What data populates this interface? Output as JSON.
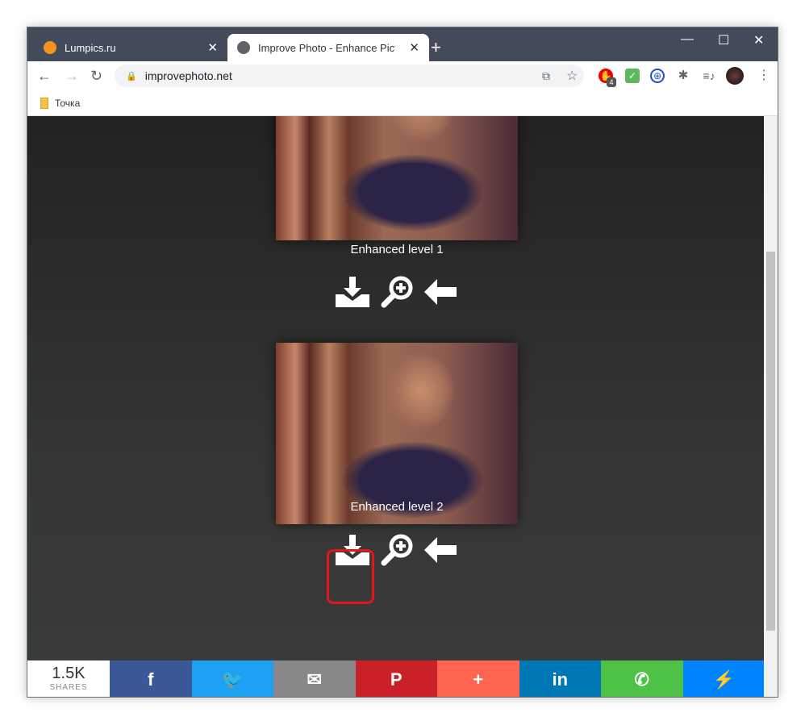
{
  "browser": {
    "tabs": [
      {
        "title": "Lumpics.ru",
        "active": false
      },
      {
        "title": "Improve Photo - Enhance Picture",
        "active": true
      }
    ],
    "url": "improvephoto.net",
    "bookmarks": [
      {
        "label": "Точка"
      }
    ],
    "extension_badge": "4"
  },
  "page": {
    "results": [
      {
        "caption": "Enhanced level 1"
      },
      {
        "caption": "Enhanced level 2"
      }
    ],
    "highlight_color": "#e3161b"
  },
  "share": {
    "count": "1.5K",
    "count_label": "SHARES",
    "buttons": [
      {
        "name": "facebook",
        "glyph": "f",
        "color": "#3b5998"
      },
      {
        "name": "twitter",
        "glyph": "🐦",
        "color": "#1da1f2"
      },
      {
        "name": "email",
        "glyph": "✉",
        "color": "#888888"
      },
      {
        "name": "pinterest",
        "glyph": "P",
        "color": "#cb2027"
      },
      {
        "name": "more",
        "glyph": "+",
        "color": "#ff6550"
      },
      {
        "name": "linkedin",
        "glyph": "in",
        "color": "#0077b5"
      },
      {
        "name": "whatsapp",
        "glyph": "✆",
        "color": "#4dc247"
      },
      {
        "name": "messenger",
        "glyph": "⚡",
        "color": "#0084ff"
      }
    ]
  }
}
